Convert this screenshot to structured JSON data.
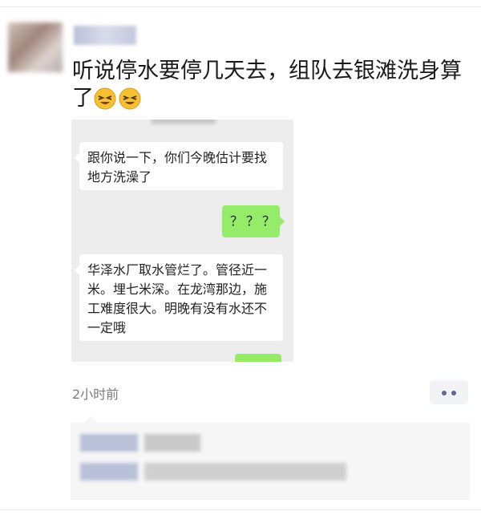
{
  "post": {
    "text": "听说停水要停几天去，组队去银滩洗身算了",
    "emoji_icons": [
      "squinting-smile-emoji",
      "squinting-smile-emoji"
    ],
    "time": "2小时前"
  },
  "screenshot": {
    "messages": [
      {
        "side": "left",
        "text": "跟你说一下，你们今晚估计要找地方洗澡了"
      },
      {
        "side": "right",
        "text": "？？？"
      },
      {
        "side": "left",
        "text": "华泽水厂取水管烂了。管径近一米。埋七米深。在龙湾那边，施工难度很大。明晚有没有水还不一定哦"
      },
      {
        "side": "right",
        "text": ""
      }
    ]
  },
  "colors": {
    "bubble_green": "#95ec69",
    "bubble_white": "#ffffff",
    "chat_bg": "#ededed",
    "more_dots": "#5b6a92"
  }
}
